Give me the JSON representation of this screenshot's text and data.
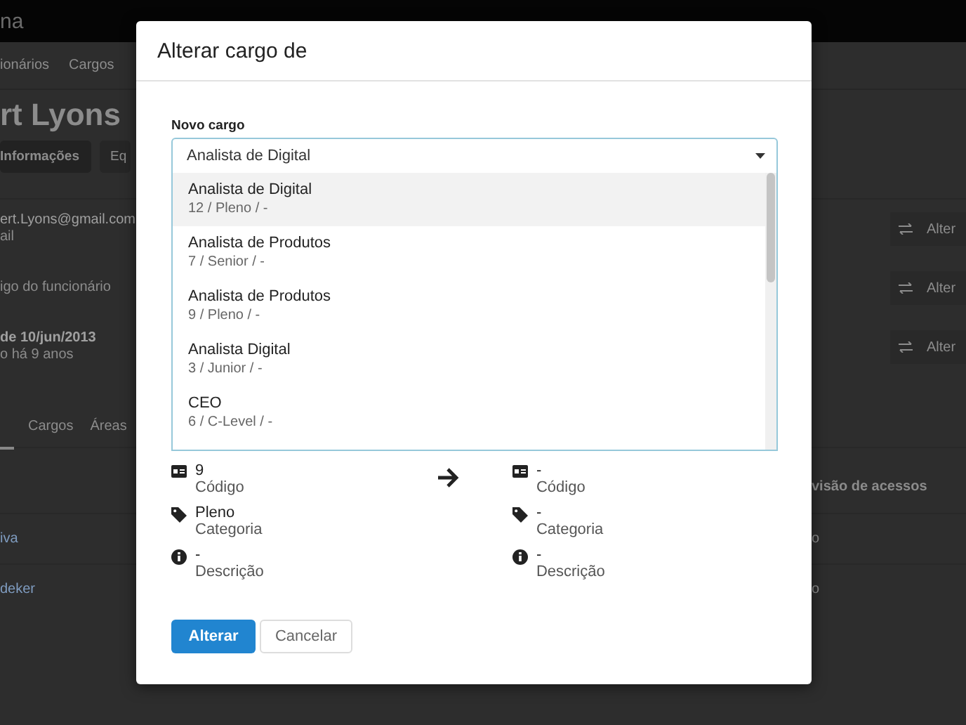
{
  "background": {
    "brand": "na",
    "nav": [
      "ionários",
      "Cargos"
    ],
    "name": "rt Lyons",
    "buttons": [
      {
        "label": "Informações",
        "selected": true
      },
      {
        "label": "Eq",
        "selected": false
      }
    ],
    "fields": [
      {
        "value": "ert.Lyons@gmail.com",
        "caption": "ail",
        "action": "Alter"
      },
      {
        "caption": "igo do funcionário",
        "action": "Alter"
      },
      {
        "value": "de 10/jun/2013",
        "caption": "o há 9 anos",
        "action": "Alter"
      }
    ],
    "tabs": [
      "Cargos",
      "Áreas"
    ],
    "table": {
      "header": "visão de acessos",
      "rows": [
        {
          "column_1": "iva",
          "column_2": "o"
        },
        {
          "column_1": "deker",
          "column_2": "o"
        }
      ]
    }
  },
  "modal": {
    "title": "Alterar cargo de",
    "field_label": "Novo cargo",
    "select_value": "Analista de Digital",
    "options": [
      {
        "name": "Analista de Digital",
        "detail": "12 / Pleno / -",
        "selected": true
      },
      {
        "name": "Analista de Produtos",
        "detail": "7 / Senior / -",
        "selected": false
      },
      {
        "name": "Analista de Produtos",
        "detail": "9 / Pleno / -",
        "selected": false
      },
      {
        "name": "Analista Digital",
        "detail": "3 / Junior / -",
        "selected": false
      },
      {
        "name": "CEO",
        "detail": "6 / C-Level / -",
        "selected": false
      }
    ],
    "current": [
      {
        "kind": "code",
        "value": "9",
        "label": "Código"
      },
      {
        "kind": "category",
        "value": "Pleno",
        "label": "Categoria"
      },
      {
        "kind": "description",
        "value": "-",
        "label": "Descrição"
      }
    ],
    "new": [
      {
        "kind": "code",
        "value": "-",
        "label": "Código"
      },
      {
        "kind": "category",
        "value": "-",
        "label": "Categoria"
      },
      {
        "kind": "description",
        "value": "-",
        "label": "Descrição"
      }
    ],
    "buttons": [
      {
        "kind": "primary",
        "label": "Alterar"
      },
      {
        "kind": "secondary",
        "label": "Cancelar"
      }
    ]
  }
}
